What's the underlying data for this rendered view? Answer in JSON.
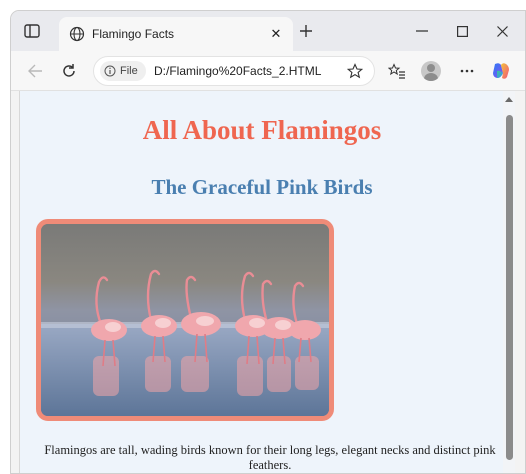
{
  "browser": {
    "tab": {
      "title": "Flamingo Facts",
      "close_glyph": "✕"
    },
    "new_tab_glyph": "+",
    "address": {
      "site_info_label": "File",
      "url": "D:/Flamingo%20Facts_2.HTML"
    },
    "window_controls": [
      "minimize-icon",
      "maximize-icon",
      "close-icon"
    ],
    "toolbar_icons": [
      "back-arrow-icon",
      "refresh-icon",
      "favorites-star-icon",
      "favorites-list-icon",
      "profile-avatar",
      "more-icon",
      "copilot-icon"
    ]
  },
  "page": {
    "heading": "All About Flamingos",
    "subheading": "The Graceful Pink Birds",
    "image_alt": "",
    "description": "Flamingos are tall, wading birds known for their long legs, elegant necks and distinct pink feathers."
  },
  "colors": {
    "heading": "#ef6650",
    "subheading": "#4a7fb0",
    "page_background": "#eef4fb",
    "image_border": "#ef8b78"
  }
}
